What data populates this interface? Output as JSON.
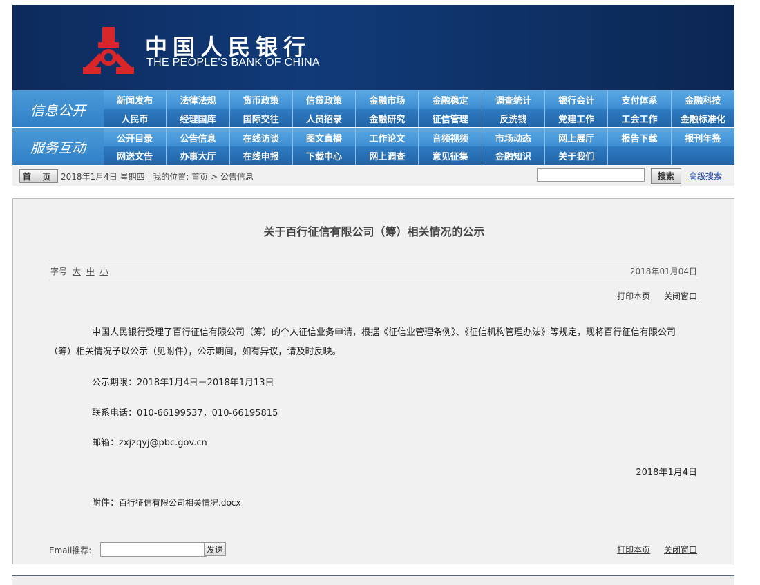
{
  "header": {
    "cn_name": "中国人民银行",
    "en_name": "THE PEOPLE'S BANK OF CHINA",
    "logo_icon": "pboc-logo-icon"
  },
  "nav": {
    "group1_label": "信息公开",
    "group2_label": "服务互动",
    "row1": [
      "新闻发布",
      "法律法规",
      "货币政策",
      "信贷政策",
      "金融市场",
      "金融稳定",
      "调查统计",
      "银行会计",
      "支付体系",
      "金融科技"
    ],
    "row2": [
      "人民币",
      "经理国库",
      "国际交往",
      "人员招录",
      "金融研究",
      "征信管理",
      "反洗钱",
      "党建工作",
      "工会工作",
      "金融标准化"
    ],
    "row3": [
      "公开目录",
      "公告信息",
      "在线访谈",
      "图文直播",
      "工作论文",
      "音频视频",
      "市场动态",
      "网上展厅",
      "报告下载",
      "报刊年鉴"
    ],
    "row4": [
      "网送文告",
      "办事大厅",
      "在线申报",
      "下载中心",
      "网上调查",
      "意见征集",
      "金融知识",
      "关于我们"
    ]
  },
  "breadcrumb": {
    "home_label": "首 页",
    "text": "2018年1月4日 星期四 | 我的位置: 首页 > 公告信息",
    "search_button": "搜索",
    "advanced_search": "高级搜索"
  },
  "article": {
    "title": "关于百行征信有限公司（筹）相关情况的公示",
    "font_size_label": "字号",
    "font_large": "大",
    "font_medium": "中",
    "font_small": "小",
    "date": "2018年01月04日",
    "print": "打印本页",
    "close": "关闭窗口",
    "para1": "中国人民银行受理了百行征信有限公司（筹）的个人征信业务申请，根据《征信业管理条例》、《征信机构管理办法》等规定，现将百行征信有限公司（筹）相关情况予以公示（见附件），公示期间，如有异议，请及时反映。",
    "period": "公示期限：2018年1月4日－2018年1月13日",
    "phone": "联系电话：010-66199537，010-66195815",
    "email_prefix": "邮箱：",
    "email": "zxjzqyj@pbc.gov.cn",
    "sign_date": "2018年1月4日",
    "attachment_label": "附件：",
    "attachment_file": "百行征信有限公司相关情况.docx",
    "email_recommend_label": "Email推荐:",
    "send_button": "发送"
  }
}
